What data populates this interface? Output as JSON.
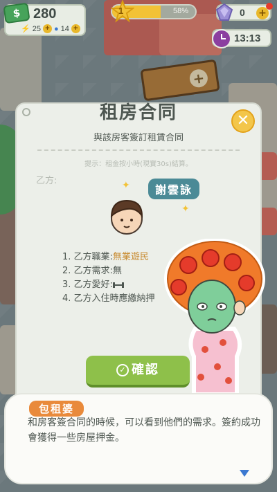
{
  "hud": {
    "money": "280",
    "energy": "25",
    "water": "14",
    "level": "1",
    "level_progress_text": "58%",
    "level_progress": 0.58,
    "gems": "0",
    "timer": "13:13"
  },
  "dialog": {
    "title": "租房合同",
    "subtitle": "與該房客簽訂租賃合同",
    "hint": "提示：租金按小時(現實30s)結算。",
    "party_label": "乙方:",
    "tenant_name": "謝雲詠",
    "terms": [
      {
        "label": "1. 乙方職業:",
        "value": "無業遊民"
      },
      {
        "label": "2. 乙方需求:",
        "value": "無"
      },
      {
        "label": "3. 乙方愛好:",
        "value": ""
      },
      {
        "label": "4. 乙方入住時應繳納押",
        "value": ""
      }
    ],
    "confirm_label": "確認"
  },
  "tutorial": {
    "speaker": "包租婆",
    "text": "和房客簽合同的時候，可以看到他們的需求。簽約成功會獲得一些房屋押金。"
  },
  "colors": {
    "accent_green": "#8ec04a",
    "accent_yellow": "#f2c236",
    "name_tag": "#4b8a96",
    "speaker_tag": "#e98a3b"
  },
  "icons": {
    "money": "money-icon",
    "energy": "bolt-icon",
    "water": "drop-icon",
    "level": "star-icon",
    "gems": "gem-icon",
    "timer": "clock-icon",
    "close": "close-icon",
    "hobby": "dumbbell-icon",
    "confirm": "check-icon",
    "next": "chevron-down-icon"
  }
}
